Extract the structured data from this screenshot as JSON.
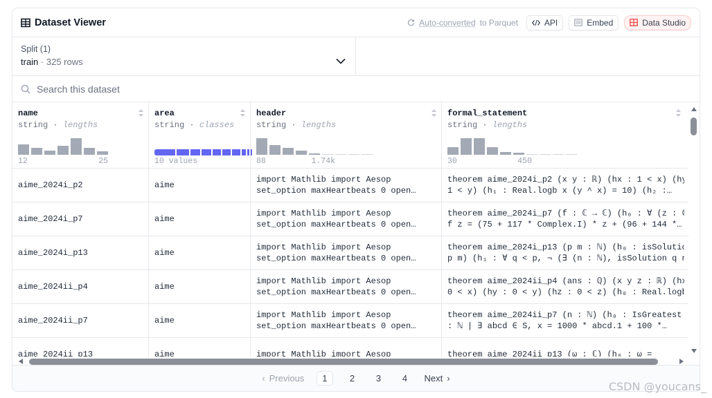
{
  "header": {
    "title": "Dataset Viewer",
    "auto_converted": "Auto-converted",
    "to_parquet": "to Parquet",
    "api_label": "API",
    "embed_label": "Embed",
    "studio_label": "Data Studio"
  },
  "split": {
    "label": "Split (1)",
    "value": "train",
    "rows": "325 rows"
  },
  "search": {
    "placeholder": "Search this dataset"
  },
  "columns": [
    {
      "name": "name",
      "type": "string",
      "stat": "lengths",
      "min": "12",
      "max": "25"
    },
    {
      "name": "area",
      "type": "string",
      "stat": "classes",
      "values": "10 values"
    },
    {
      "name": "header",
      "type": "string",
      "stat": "lengths",
      "min": "88",
      "max": "1.74k"
    },
    {
      "name": "formal_statement",
      "type": "string",
      "stat": "lengths",
      "min": "30",
      "max": "450"
    }
  ],
  "histograms": {
    "name": [
      0.55,
      0.35,
      0.2,
      0.45,
      0.85,
      0.35,
      0.18
    ],
    "header": [
      0.85,
      0.5,
      0.35,
      0.2,
      0.08,
      0,
      0,
      0,
      0
    ],
    "formal_statement": [
      0.4,
      0.85,
      0.85,
      0.4,
      0.15,
      0.12,
      0,
      0,
      0,
      0
    ]
  },
  "rows": [
    {
      "name": "aime_2024i_p2",
      "area": "aime",
      "header_l1": "import Mathlib import Aesop",
      "header_l2": "set_option maxHeartbeats 0 open…",
      "fs_l1": "theorem aime_2024i_p2 (x y : ℝ) (hx : 1 < x) (hy :",
      "fs_l2": "1 < y) (h₁ : Real.logb x (y ^ x) = 10) (h₂ :…"
    },
    {
      "name": "aime_2024i_p7",
      "area": "aime",
      "header_l1": "import Mathlib import Aesop",
      "header_l2": "set_option maxHeartbeats 0 open…",
      "fs_l1": "theorem aime_2024i_p7 (f : ℂ → ℂ) (h₀ : ∀ (z : ℂ",
      "fs_l2": "f z = (75 + 117 * Complex.I) * z + (96 + 144 *…"
    },
    {
      "name": "aime_2024i_p13",
      "area": "aime",
      "header_l1": "import Mathlib import Aesop",
      "header_l2": "set_option maxHeartbeats 0 open…",
      "fs_l1": "theorem aime_2024i_p13 (p m : ℕ) (h₀ : isSolution",
      "fs_l2": "p m) (h₁ : ∀ q < p, ¬ (∃ (n : ℕ), isSolution q n"
    },
    {
      "name": "aime_2024ii_p4",
      "area": "aime",
      "header_l1": "import Mathlib import Aesop",
      "header_l2": "set_option maxHeartbeats 0 open…",
      "fs_l1": "theorem aime_2024ii_p4 (ans : ℚ) (x y z : ℝ) (hx :",
      "fs_l2": "0 < x) (hy : 0 < y) (hz : 0 < z) (h₀ : Real.logb"
    },
    {
      "name": "aime_2024ii_p7",
      "area": "aime",
      "header_l1": "import Mathlib import Aesop",
      "header_l2": "set_option maxHeartbeats 0 open…",
      "fs_l1": "theorem aime_2024ii_p7 (n : ℕ) (h₀ : IsGreatest",
      "fs_l2": ": ℕ | ∃ abcd ∈ S, x = 1000 * abcd.1 + 100 *…"
    },
    {
      "name": "aime_2024ii_p13",
      "area": "aime",
      "header_l1": "import Mathlib import Aesop",
      "header_l2": "",
      "fs_l1": "theorem aime_2024ii_p13 (ω : ℂ) (h₀ : ω =",
      "fs_l2": ""
    }
  ],
  "pagination": {
    "previous": "Previous",
    "pages": [
      "1",
      "2",
      "3",
      "4"
    ],
    "next": "Next"
  },
  "watermark": "CSDN @youcans_",
  "colors": {
    "accent": "#6366f1",
    "studio_bg": "#fef2f2",
    "studio_icon": "#ef4444"
  }
}
